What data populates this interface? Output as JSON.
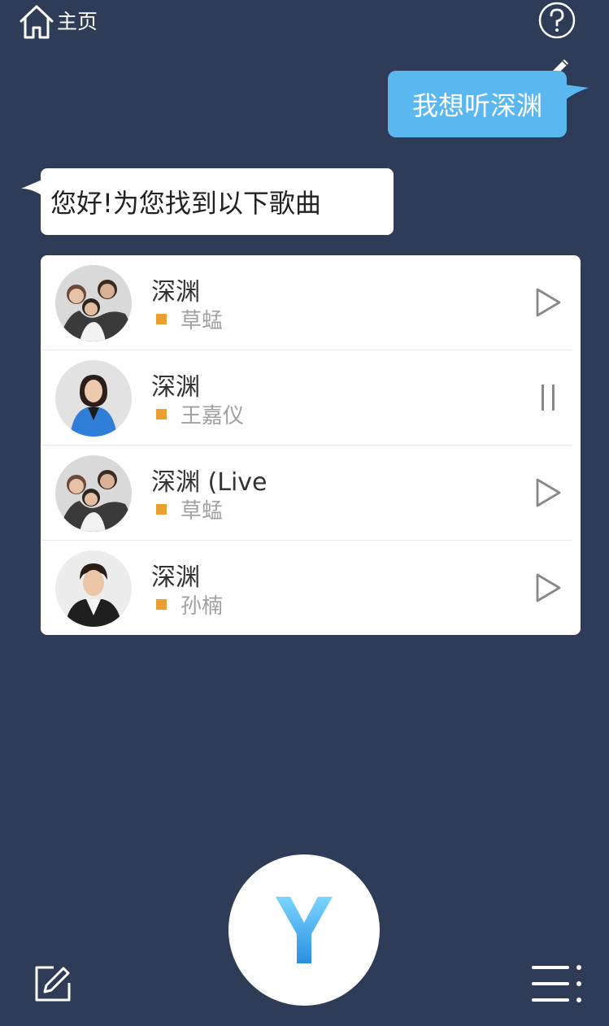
{
  "header": {
    "home_label": "主页",
    "home_icon": "home-icon",
    "help_icon": "help-icon"
  },
  "conversation": {
    "user_message": "我想听深渊",
    "bot_message": "您好!为您找到以下歌曲"
  },
  "songs": [
    {
      "title": "深渊",
      "artist": "草蜢",
      "state": "play",
      "avatar": "group-photo"
    },
    {
      "title": "深渊",
      "artist": "王嘉仪",
      "state": "pause",
      "avatar": "singer-photo"
    },
    {
      "title": "深渊 (Live",
      "artist": "草蜢",
      "state": "play",
      "avatar": "group-photo"
    },
    {
      "title": "深渊",
      "artist": "孙楠",
      "state": "play",
      "avatar": "singer-photo"
    }
  ],
  "footer": {
    "voice_button_glyph": "Y",
    "compose_icon": "edit-icon",
    "menu_icon": "menu-icon"
  },
  "colors": {
    "background": "#2e3c57",
    "user_bubble": "#5bb7ef",
    "artist_marker": "#e9a030",
    "logo_gradient_top": "#7ad5ff",
    "logo_gradient_bottom": "#2a8fe0"
  }
}
